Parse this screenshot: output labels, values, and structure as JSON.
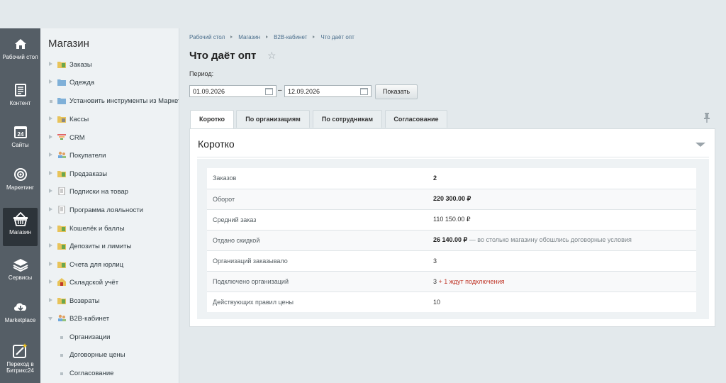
{
  "rail": [
    {
      "label": "Рабочий стол",
      "icon": "home-icon"
    },
    {
      "label": "Контент",
      "icon": "document-icon"
    },
    {
      "label": "Сайты",
      "icon": "calendar-24-icon"
    },
    {
      "label": "Маркетинг",
      "icon": "target-icon"
    },
    {
      "label": "Магазин",
      "icon": "basket-icon",
      "active": true
    },
    {
      "label": "Сервисы",
      "icon": "layers-icon"
    },
    {
      "label": "Marketplace",
      "icon": "cloud-download-icon"
    },
    {
      "label": "Переход в Битрикс24",
      "icon": "wand-icon"
    }
  ],
  "menu": {
    "title": "Магазин",
    "items": [
      {
        "label": "Заказы"
      },
      {
        "label": "Одежда"
      },
      {
        "label": "Установить инструменты из Маркетплейса"
      },
      {
        "label": "Кассы"
      },
      {
        "label": "CRM"
      },
      {
        "label": "Покупатели"
      },
      {
        "label": "Предзаказы"
      },
      {
        "label": "Подписки на товар"
      },
      {
        "label": "Программа лояльности"
      },
      {
        "label": "Кошелёк и баллы"
      },
      {
        "label": "Депозиты и лимиты"
      },
      {
        "label": "Счета для юрлиц"
      },
      {
        "label": "Складской учёт"
      },
      {
        "label": "Возвраты"
      },
      {
        "label": "B2B-кабинет"
      },
      {
        "label": "Организации"
      },
      {
        "label": "Договорные цены"
      },
      {
        "label": "Согласование"
      }
    ]
  },
  "breadcrumb": [
    "Рабочий стол",
    "Магазин",
    "B2B-кабинет",
    "Что даёт опт"
  ],
  "page": {
    "title": "Что даёт опт",
    "period_label": "Период:",
    "date_from": "01.09.2026",
    "date_to": "12.09.2026",
    "dash": "–",
    "show_button": "Показать"
  },
  "tabs": [
    "Коротко",
    "По организациям",
    "По сотрудникам",
    "Согласование"
  ],
  "panel": {
    "title": "Коротко",
    "rows": [
      {
        "label": "Заказов",
        "value": "2"
      },
      {
        "label": "Оборот",
        "value": "220 300.00 ₽"
      },
      {
        "label": "Средний заказ",
        "value": "110 150.00 ₽"
      },
      {
        "label": "Отдано скидкой",
        "value": "26 140.00 ₽",
        "note": " — во столько магазину обошлись договорные условия"
      },
      {
        "label": "Организаций заказывало",
        "value": "3"
      },
      {
        "label": "Подключено организаций",
        "value": "3",
        "extra": " + 1 ждут подключения"
      },
      {
        "label": "Действующих правил цены",
        "value": "10"
      }
    ]
  },
  "colors": {
    "rail": "#555e66",
    "rail_active": "#2d343a",
    "link": "#4a6e8c",
    "warning": "#c0392b"
  }
}
